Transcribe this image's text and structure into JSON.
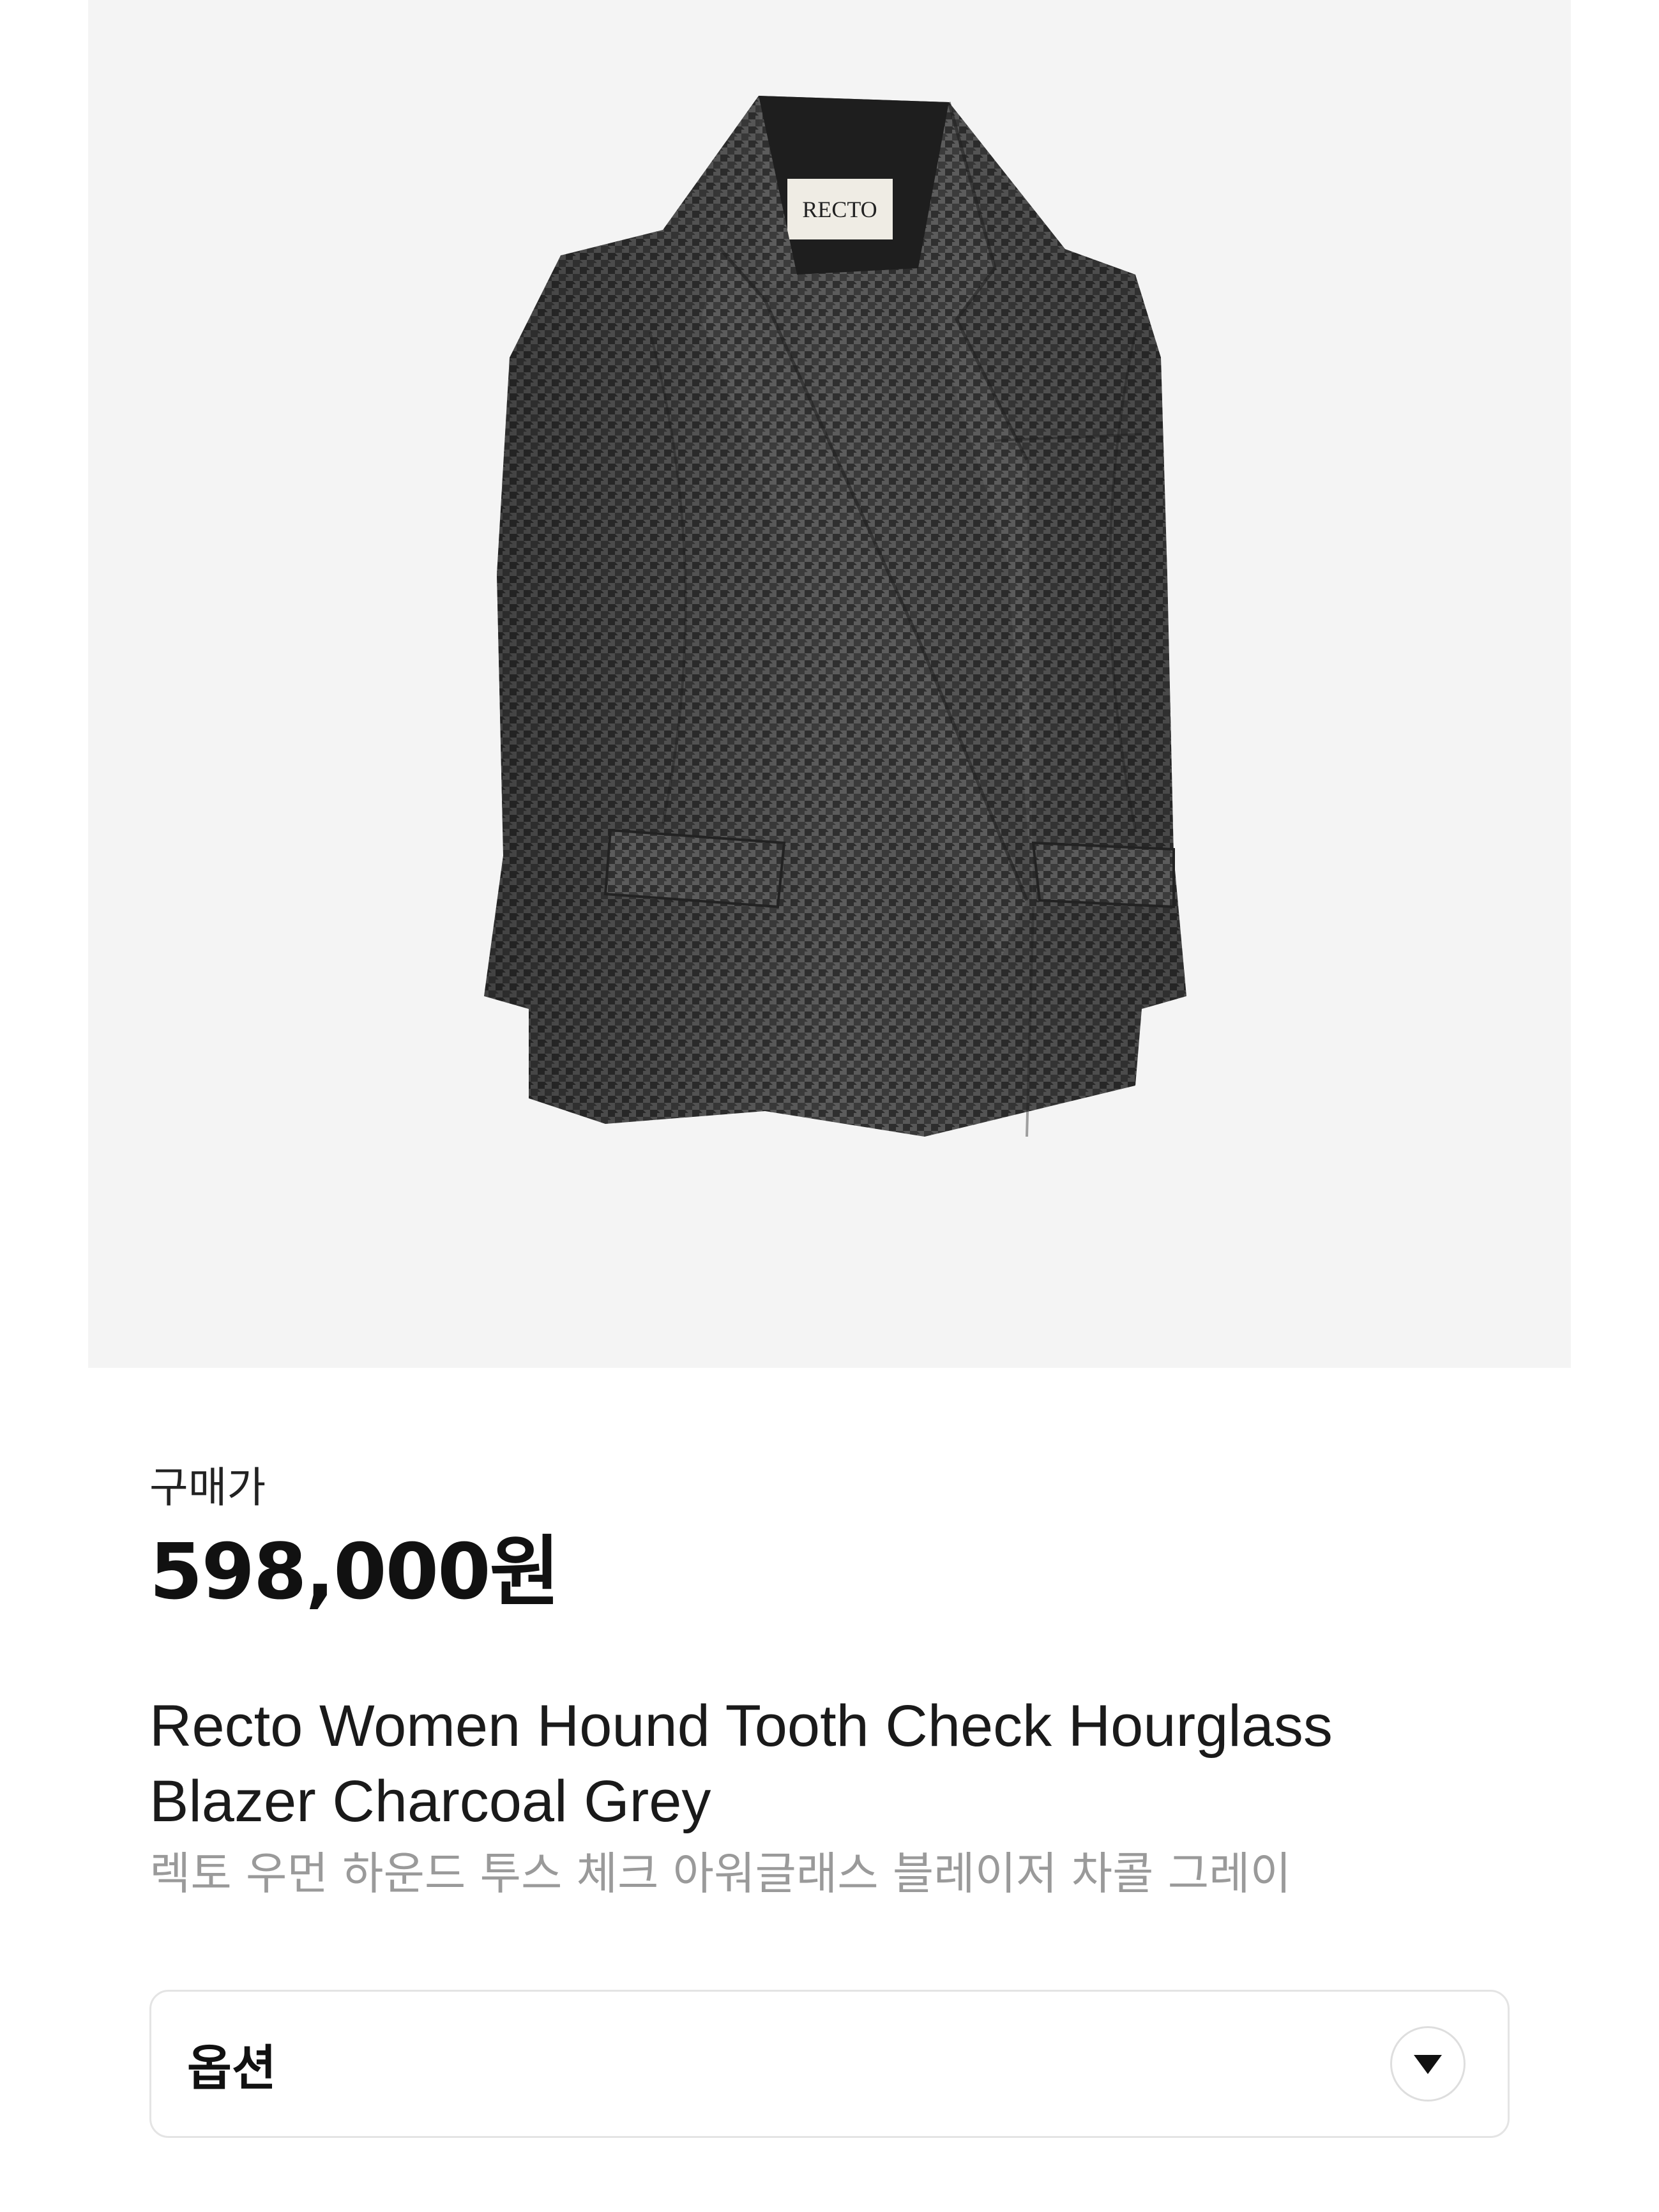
{
  "product": {
    "image_alt": "Recto hound tooth check blazer charcoal grey",
    "brand_label": "RECTO",
    "colors": {
      "image_background": "#f4f4f4",
      "fabric_dark": "#3a3a3a",
      "fabric_light": "#6a6a6a"
    }
  },
  "pricing": {
    "label": "구매가",
    "amount": "598,000원"
  },
  "title": {
    "english": "Recto Women Hound Tooth Check Hourglass Blazer Charcoal Grey",
    "korean": "렉토 우먼 하운드 투스 체크 아워글래스 블레이저 차콜 그레이"
  },
  "options": {
    "label": "옵션",
    "icon": "chevron-down-icon"
  }
}
